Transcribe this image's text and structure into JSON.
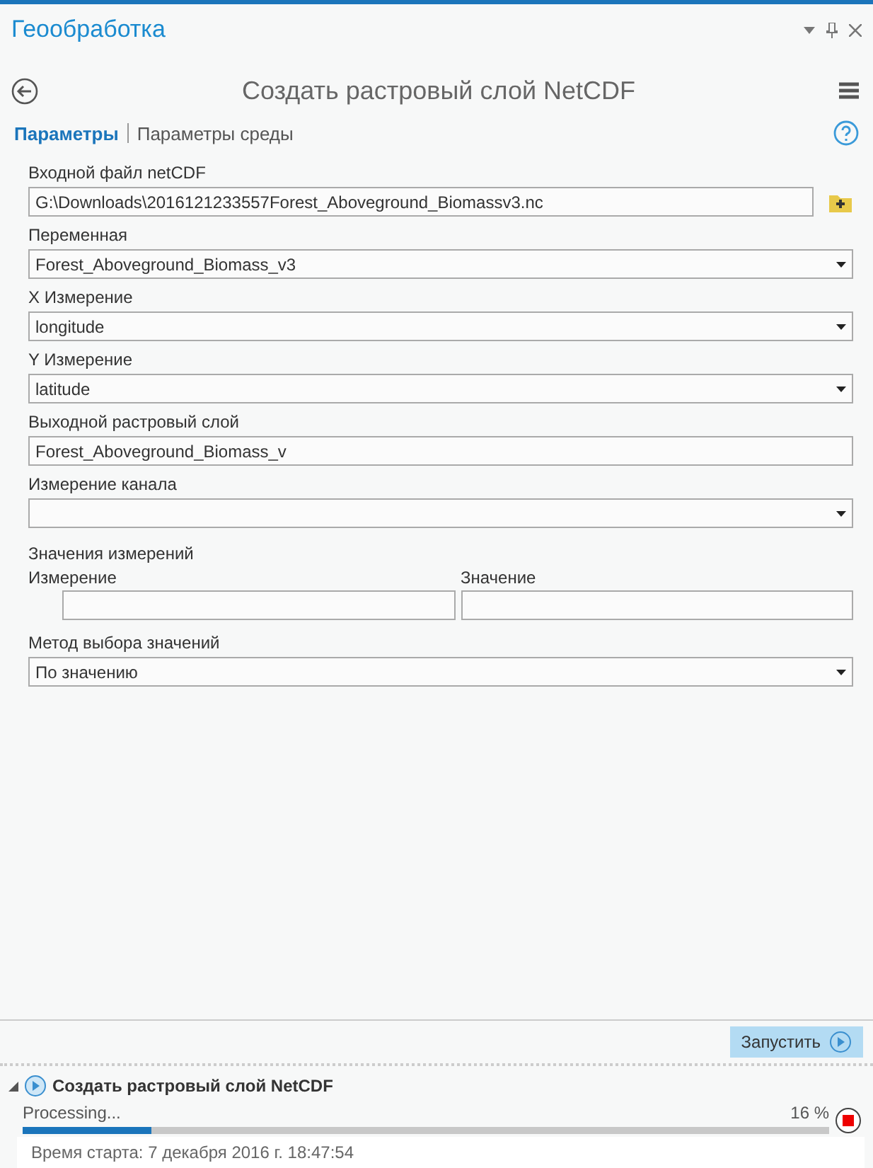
{
  "window": {
    "title": "Геообработка"
  },
  "tool": {
    "title": "Создать растровый слой NetCDF"
  },
  "tabs": [
    {
      "label": "Параметры",
      "selected": true
    },
    {
      "label": "Параметры среды",
      "selected": false
    }
  ],
  "parameters": [
    {
      "kind": "file",
      "label": "Входной файл netCDF",
      "value": "G:\\Downloads\\2016121233557Forest_Aboveground_Biomassv3.nc"
    },
    {
      "kind": "dropdown",
      "label": "Переменная",
      "value": "Forest_Aboveground_Biomass_v3"
    },
    {
      "kind": "dropdown",
      "label": "X Измерение",
      "value": "longitude"
    },
    {
      "kind": "dropdown",
      "label": "Y Измерение",
      "value": "latitude"
    },
    {
      "kind": "text",
      "label": "Выходной растровый слой",
      "value": "Forest_Aboveground_Biomass_v"
    },
    {
      "kind": "dropdown",
      "label": "Измерение канала"
    },
    {
      "kind": "table",
      "label": "Значения измерений",
      "columns": [
        "Измерение",
        "Значение"
      ]
    },
    {
      "kind": "dropdown",
      "label": "Метод выбора значений",
      "value": "По значению"
    }
  ],
  "run_button": "Запустить",
  "result": {
    "title": "Создать растровый слой NetCDF",
    "expanded": true,
    "status": "Processing...",
    "percent": "16 %",
    "level": 0.16,
    "start_time": "Время старта: 7 декабря 2016 г. 18:47:54"
  }
}
